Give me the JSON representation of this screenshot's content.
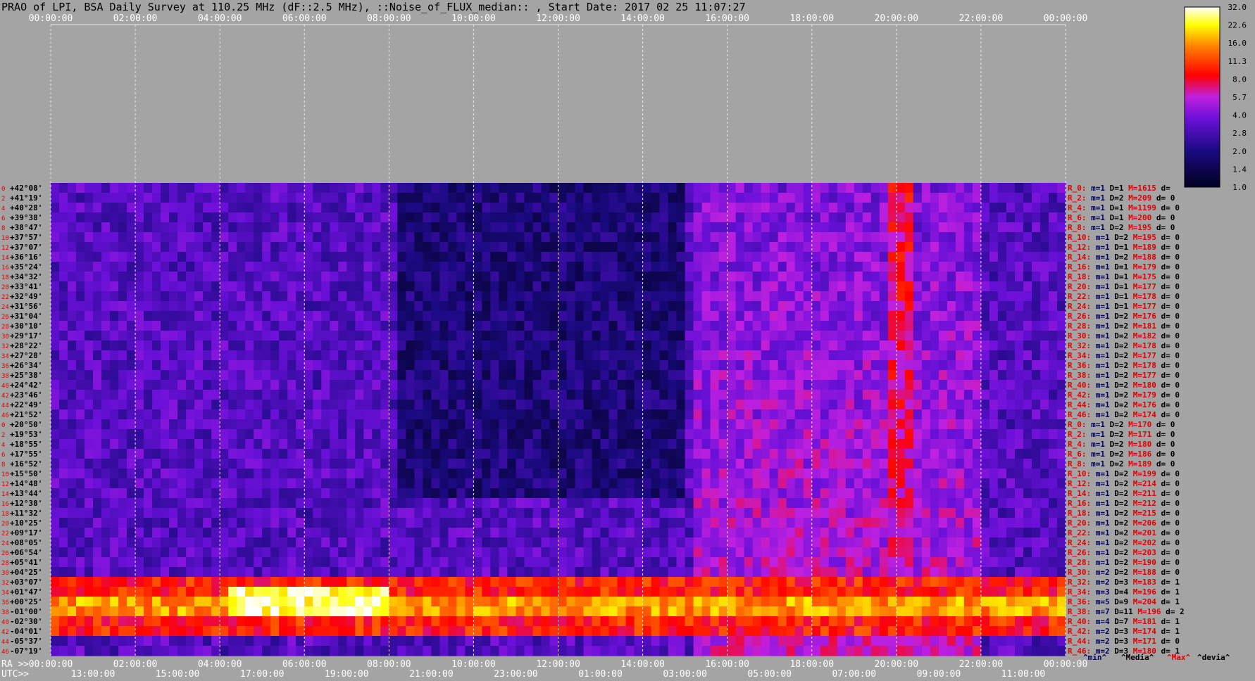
{
  "title": "PRAO of LPI, BSA Daily Survey at 110.25 MHz (dF::2.5 MHz), ::Noise_of_FLUX_median:: , Start Date: 2017 02 25 11:07:27",
  "chart_data": {
    "type": "heatmap",
    "title": "PRAO of LPI, BSA Daily Survey at 110.25 MHz (dF::2.5 MHz), ::Noise_of_FLUX_median:: , Start Date: 2017 02 25 11:07:27",
    "x_top_ticks": [
      "00:00:00",
      "02:00:00",
      "04:00:00",
      "06:00:00",
      "08:00:00",
      "10:00:00",
      "12:00:00",
      "14:00:00",
      "16:00:00",
      "18:00:00",
      "20:00:00",
      "22:00:00",
      "00:00:00"
    ],
    "x_bottom_ra_prefix": "RA >>",
    "x_bottom_ra_ticks": [
      "00:00:00",
      "02:00:00",
      "04:00:00",
      "06:00:00",
      "08:00:00",
      "10:00:00",
      "12:00:00",
      "14:00:00",
      "16:00:00",
      "18:00:00",
      "20:00:00",
      "22:00:00",
      "00:00:00"
    ],
    "x_bottom_utc_prefix": "UTC>>",
    "x_bottom_utc_ticks": [
      "13:00:00",
      "15:00:00",
      "17:00:00",
      "19:00:00",
      "21:00:00",
      "23:00:00",
      "01:00:00",
      "03:00:00",
      "05:00:00",
      "07:00:00",
      "09:00:00",
      "11:00:00"
    ],
    "declinations": [
      "+42°08'",
      "+41°19'",
      "+40°28'",
      "+39°38'",
      "+38°47'",
      "+37°57'",
      "+37°07'",
      "+36°16'",
      "+35°24'",
      "+34°32'",
      "+33°41'",
      "+32°49'",
      "+31°56'",
      "+31°04'",
      "+30°10'",
      "+29°17'",
      "+28°22'",
      "+27°28'",
      "+26°34'",
      "+25°38'",
      "+24°42'",
      "+23°46'",
      "+22°49'",
      "+21°52'",
      "+20°50'",
      "+19°53'",
      "+18°55'",
      "+17°55'",
      "+16°52'",
      "+15°50'",
      "+14°48'",
      "+13°44'",
      "+12°38'",
      "+11°32'",
      "+10°25'",
      "+09°17'",
      "+08°05'",
      "+06°54'",
      "+05°41'",
      "+04°25'",
      "+03°07'",
      "+01°47'",
      "+00°25'",
      "-01°00'",
      "-02°30'",
      "-04°01'",
      "-05°37'",
      "-07°19'"
    ],
    "row_index_labels": [
      "0",
      "2",
      "4",
      "6",
      "8",
      "10",
      "12",
      "14",
      "16",
      "18",
      "20",
      "22",
      "24",
      "26",
      "28",
      "30",
      "32",
      "34",
      "36",
      "38",
      "40",
      "42",
      "44",
      "46",
      "0",
      "2",
      "4",
      "6",
      "8",
      "10",
      "12",
      "14",
      "16",
      "18",
      "20",
      "22",
      "24",
      "26",
      "28",
      "30",
      "32",
      "34",
      "36",
      "38",
      "40",
      "42",
      "44",
      "46"
    ],
    "colorbar": {
      "ticks": [
        "32.0",
        "22.6",
        "16.0",
        "11.3",
        "8.0",
        "5.7",
        "4.0",
        "2.8",
        "2.0",
        "1.4",
        "1.0"
      ],
      "min": 1.0,
      "max": 32.0,
      "scale": "log"
    },
    "stats_header": {
      "min": "^min^",
      "median": "^Media^",
      "max": "^Max^",
      "dev": "^devia^"
    },
    "stats": [
      {
        "r": "R_0:",
        "m": "1",
        "D": "1",
        "M": "1615",
        "d": ""
      },
      {
        "r": "R_2:",
        "m": "1",
        "D": "2",
        "M": "209",
        "d": "0"
      },
      {
        "r": "R_4:",
        "m": "1",
        "D": "1",
        "M": "1199",
        "d": "0"
      },
      {
        "r": "R_6:",
        "m": "1",
        "D": "1",
        "M": "200",
        "d": "0"
      },
      {
        "r": "R_8:",
        "m": "1",
        "D": "2",
        "M": "195",
        "d": "0"
      },
      {
        "r": "R_10:",
        "m": "1",
        "D": "2",
        "M": "195",
        "d": "0"
      },
      {
        "r": "R_12:",
        "m": "1",
        "D": "1",
        "M": "189",
        "d": "0"
      },
      {
        "r": "R_14:",
        "m": "1",
        "D": "2",
        "M": "188",
        "d": "0"
      },
      {
        "r": "R_16:",
        "m": "1",
        "D": "1",
        "M": "179",
        "d": "0"
      },
      {
        "r": "R_18:",
        "m": "1",
        "D": "1",
        "M": "175",
        "d": "0"
      },
      {
        "r": "R_20:",
        "m": "1",
        "D": "1",
        "M": "177",
        "d": "0"
      },
      {
        "r": "R_22:",
        "m": "1",
        "D": "1",
        "M": "178",
        "d": "0"
      },
      {
        "r": "R_24:",
        "m": "1",
        "D": "1",
        "M": "177",
        "d": "0"
      },
      {
        "r": "R_26:",
        "m": "1",
        "D": "2",
        "M": "176",
        "d": "0"
      },
      {
        "r": "R_28:",
        "m": "1",
        "D": "2",
        "M": "181",
        "d": "0"
      },
      {
        "r": "R_30:",
        "m": "1",
        "D": "2",
        "M": "182",
        "d": "0"
      },
      {
        "r": "R_32:",
        "m": "1",
        "D": "2",
        "M": "178",
        "d": "0"
      },
      {
        "r": "R_34:",
        "m": "1",
        "D": "2",
        "M": "177",
        "d": "0"
      },
      {
        "r": "R_36:",
        "m": "1",
        "D": "2",
        "M": "178",
        "d": "0"
      },
      {
        "r": "R_38:",
        "m": "1",
        "D": "2",
        "M": "177",
        "d": "0"
      },
      {
        "r": "R_40:",
        "m": "1",
        "D": "2",
        "M": "180",
        "d": "0"
      },
      {
        "r": "R_42:",
        "m": "1",
        "D": "2",
        "M": "179",
        "d": "0"
      },
      {
        "r": "R_44:",
        "m": "1",
        "D": "2",
        "M": "176",
        "d": "0"
      },
      {
        "r": "R_46:",
        "m": "1",
        "D": "2",
        "M": "174",
        "d": "0"
      },
      {
        "r": "R_0:",
        "m": "1",
        "D": "2",
        "M": "170",
        "d": "0"
      },
      {
        "r": "R_2:",
        "m": "1",
        "D": "2",
        "M": "171",
        "d": "0"
      },
      {
        "r": "R_4:",
        "m": "1",
        "D": "2",
        "M": "180",
        "d": "0"
      },
      {
        "r": "R_6:",
        "m": "1",
        "D": "2",
        "M": "186",
        "d": "0"
      },
      {
        "r": "R_8:",
        "m": "1",
        "D": "2",
        "M": "189",
        "d": "0"
      },
      {
        "r": "R_10:",
        "m": "1",
        "D": "2",
        "M": "199",
        "d": "0"
      },
      {
        "r": "R_12:",
        "m": "1",
        "D": "2",
        "M": "214",
        "d": "0"
      },
      {
        "r": "R_14:",
        "m": "1",
        "D": "2",
        "M": "211",
        "d": "0"
      },
      {
        "r": "R_16:",
        "m": "1",
        "D": "2",
        "M": "212",
        "d": "0"
      },
      {
        "r": "R_18:",
        "m": "1",
        "D": "2",
        "M": "215",
        "d": "0"
      },
      {
        "r": "R_20:",
        "m": "1",
        "D": "2",
        "M": "206",
        "d": "0"
      },
      {
        "r": "R_22:",
        "m": "1",
        "D": "2",
        "M": "201",
        "d": "0"
      },
      {
        "r": "R_24:",
        "m": "1",
        "D": "2",
        "M": "202",
        "d": "0"
      },
      {
        "r": "R_26:",
        "m": "1",
        "D": "2",
        "M": "203",
        "d": "0"
      },
      {
        "r": "R_28:",
        "m": "1",
        "D": "2",
        "M": "190",
        "d": "0"
      },
      {
        "r": "R_30:",
        "m": "2",
        "D": "2",
        "M": "188",
        "d": "0"
      },
      {
        "r": "R_32:",
        "m": "2",
        "D": "3",
        "M": "183",
        "d": "1"
      },
      {
        "r": "R_34:",
        "m": "3",
        "D": "4",
        "M": "196",
        "d": "1"
      },
      {
        "r": "R_36:",
        "m": "5",
        "D": "9",
        "M": "204",
        "d": "1"
      },
      {
        "r": "R_38:",
        "m": "7",
        "D": "11",
        "M": "196",
        "d": "2"
      },
      {
        "r": "R_40:",
        "m": "4",
        "D": "7",
        "M": "181",
        "d": "1"
      },
      {
        "r": "R_42:",
        "m": "2",
        "D": "3",
        "M": "174",
        "d": "1"
      },
      {
        "r": "R_44:",
        "m": "2",
        "D": "3",
        "M": "171",
        "d": "0"
      },
      {
        "r": "R_46:",
        "m": "2",
        "D": "3",
        "M": "180",
        "d": "1"
      }
    ],
    "colors": {
      "background": "#a4a4a4",
      "min_color": "#000000",
      "mid_color": "#8000ff",
      "high_color": "#ff0000",
      "max_color": "#ffffff"
    }
  }
}
